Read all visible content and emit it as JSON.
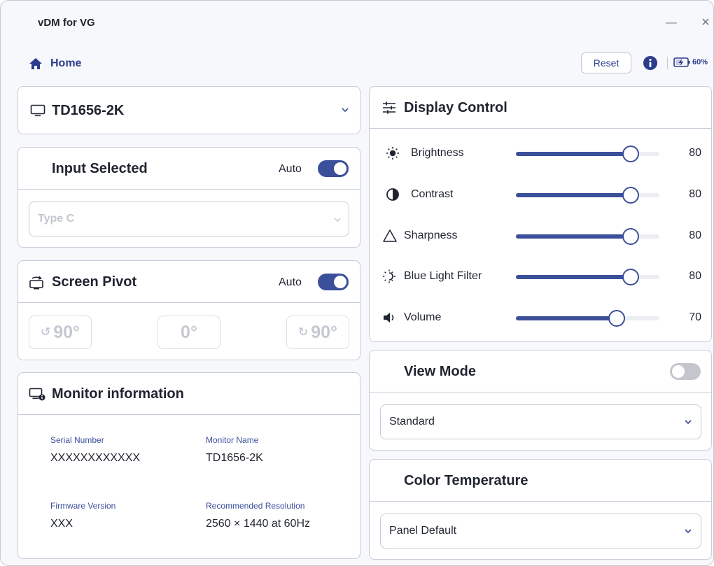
{
  "app": {
    "title": "vDM for  VG",
    "minimize_glyph": "—",
    "close_glyph": "✕"
  },
  "nav": {
    "home_label": "Home",
    "reset_label": "Reset",
    "battery_label": "60%",
    "battery_level": 0.6
  },
  "monitor_select": {
    "value": "TD1656-2K"
  },
  "input_selected": {
    "title": "Input Selected",
    "auto_label": "Auto",
    "auto_on": true,
    "source": "Type C"
  },
  "screen_pivot": {
    "title": "Screen Pivot",
    "auto_label": "Auto",
    "auto_on": true,
    "buttons": [
      {
        "label": "90°",
        "icon": "rotate-ccw-icon"
      },
      {
        "label": "0°"
      },
      {
        "label": "90°",
        "icon": "rotate-cw-icon"
      }
    ]
  },
  "monitor_info": {
    "title": "Monitor information",
    "serial_label": "Serial Number",
    "serial_value": "XXXXXXXXXXXX",
    "name_label": "Monitor Name",
    "name_value": "TD1656-2K",
    "firmware_label": "Firmware Version",
    "firmware_value": "XXX",
    "resolution_label": "Recommended Resolution",
    "resolution_value": "2560 × 1440 at 60Hz"
  },
  "display_control": {
    "title": "Display Control",
    "rows": [
      {
        "label": "Brightness",
        "value": "80",
        "level": 80,
        "icon": "sun-icon"
      },
      {
        "label": "Contrast",
        "value": "80",
        "level": 80,
        "icon": "contrast-icon"
      },
      {
        "label": "Sharpness",
        "value": "80",
        "level": 80,
        "icon": "triangle-icon"
      },
      {
        "label": "Blue Light Filter",
        "value": "80",
        "level": 80,
        "icon": "blue-light-icon"
      },
      {
        "label": "Volume",
        "value": "70",
        "level": 70,
        "icon": "speaker-icon"
      }
    ]
  },
  "view_mode": {
    "title": "View Mode",
    "enabled": false,
    "value": "Standard"
  },
  "color_temperature": {
    "title": "Color Temperature",
    "value": "Panel Default"
  },
  "colors": {
    "accent": "#3b4f9a",
    "text": "#1f2430",
    "muted": "#c3c6cf",
    "border": "#c9ccd8"
  }
}
